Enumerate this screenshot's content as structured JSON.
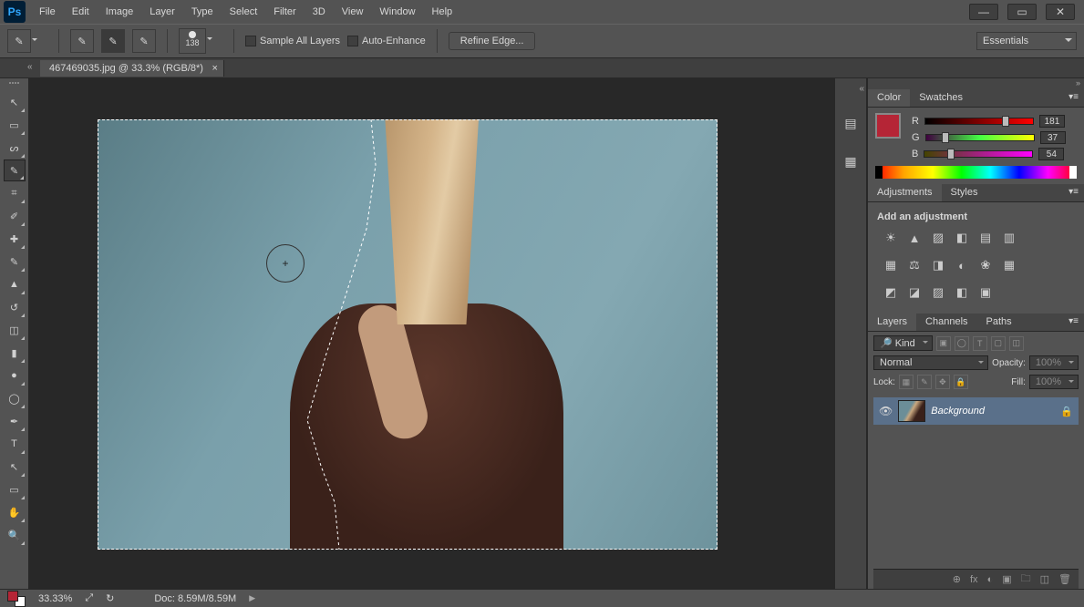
{
  "app": {
    "logo_text": "Ps"
  },
  "menu": [
    "File",
    "Edit",
    "Image",
    "Layer",
    "Type",
    "Select",
    "Filter",
    "3D",
    "View",
    "Window",
    "Help"
  ],
  "window_controls": {
    "minimize": "—",
    "maximize": "▭",
    "close": "✕"
  },
  "options_bar": {
    "brush_size_label": "138",
    "sample_all_layers": "Sample All Layers",
    "auto_enhance": "Auto-Enhance",
    "refine_edge": "Refine Edge...",
    "workspace": "Essentials"
  },
  "document": {
    "tab_title": "467469035.jpg @ 33.3% (RGB/8*)",
    "tab_close": "×"
  },
  "tools": [
    {
      "name": "move-tool",
      "glyph": "↖",
      "active": false
    },
    {
      "name": "marquee-tool",
      "glyph": "▭",
      "active": false
    },
    {
      "name": "lasso-tool",
      "glyph": "ᔕ",
      "active": false
    },
    {
      "name": "quick-selection-tool",
      "glyph": "✎",
      "active": true
    },
    {
      "name": "crop-tool",
      "glyph": "⌗",
      "active": false
    },
    {
      "name": "eyedropper-tool",
      "glyph": "✐",
      "active": false
    },
    {
      "name": "healing-tool",
      "glyph": "✚",
      "active": false
    },
    {
      "name": "brush-tool",
      "glyph": "✎",
      "active": false
    },
    {
      "name": "stamp-tool",
      "glyph": "▲",
      "active": false
    },
    {
      "name": "history-brush-tool",
      "glyph": "↺",
      "active": false
    },
    {
      "name": "eraser-tool",
      "glyph": "◫",
      "active": false
    },
    {
      "name": "gradient-tool",
      "glyph": "▮",
      "active": false
    },
    {
      "name": "blur-tool",
      "glyph": "●",
      "active": false
    },
    {
      "name": "dodge-tool",
      "glyph": "◯",
      "active": false
    },
    {
      "name": "pen-tool",
      "glyph": "✒",
      "active": false
    },
    {
      "name": "type-tool",
      "glyph": "T",
      "active": false
    },
    {
      "name": "path-selection-tool",
      "glyph": "↖",
      "active": false
    },
    {
      "name": "shape-tool",
      "glyph": "▭",
      "active": false
    },
    {
      "name": "hand-tool",
      "glyph": "✋",
      "active": false
    },
    {
      "name": "zoom-tool",
      "glyph": "🔍",
      "active": false
    }
  ],
  "cursor_glyph": "+",
  "dock_icons": [
    {
      "name": "history-panel-icon",
      "glyph": "▤"
    },
    {
      "name": "properties-panel-icon",
      "glyph": "▦"
    }
  ],
  "color_panel": {
    "tabs": [
      "Color",
      "Swatches"
    ],
    "channels": [
      {
        "label": "R",
        "value": "181",
        "pct": 71
      },
      {
        "label": "G",
        "value": "37",
        "pct": 15
      },
      {
        "label": "B",
        "value": "54",
        "pct": 21
      }
    ],
    "fg_hex": "#b52536"
  },
  "adjustments_panel": {
    "tabs": [
      "Adjustments",
      "Styles"
    ],
    "heading": "Add an adjustment",
    "row1": [
      "☀",
      "▲",
      "▨",
      "◧",
      "▤",
      "▥"
    ],
    "row2": [
      "▦",
      "⚖",
      "◨",
      "◐",
      "❀",
      "▦"
    ],
    "row3": [
      "◩",
      "◪",
      "▨",
      "◧",
      "▣"
    ]
  },
  "layers_panel": {
    "tabs": [
      "Layers",
      "Channels",
      "Paths"
    ],
    "filter_label": "Kind",
    "filter_icons": [
      "▣",
      "◯",
      "T",
      "▢",
      "◫"
    ],
    "blend_mode": "Normal",
    "opacity_label": "Opacity:",
    "opacity_value": "100%",
    "lock_label": "Lock:",
    "lock_icons": [
      "▦",
      "✎",
      "✥",
      "🔒"
    ],
    "fill_label": "Fill:",
    "fill_value": "100%",
    "layer": {
      "name": "Background",
      "locked": true
    },
    "footer_icons": [
      "⊕",
      "fx",
      "◐",
      "▣",
      "🗀",
      "◫",
      "🗑"
    ]
  },
  "status_bar": {
    "zoom": "33.33%",
    "doc_info": "Doc:  8.59M/8.59M"
  }
}
